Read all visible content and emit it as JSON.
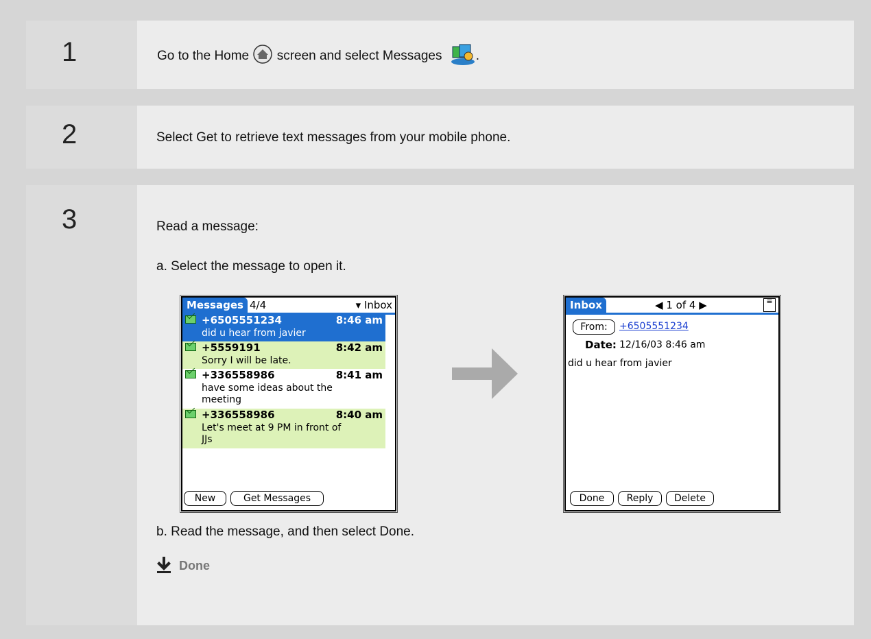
{
  "steps": [
    {
      "number": "1",
      "text_before": "Go to the Home",
      "text_middle": "screen and select Messages",
      "text_after": "."
    },
    {
      "number": "2",
      "text": "Select Get to retrieve text messages from your mobile phone."
    },
    {
      "number": "3",
      "intro": "Read a message:",
      "sub_a": "a.  Select the message to open it.",
      "sub_b": "b.  Read the message, and then select Done.",
      "done_label": "Done"
    }
  ],
  "icons": {
    "home": "home-icon",
    "messages": "messages-app-icon",
    "arrow": "right-arrow-icon",
    "done": "down-arrow-done-icon"
  },
  "colors": {
    "accent": "#1f6fd0",
    "highlight": "#ddf2b8",
    "selected": "#1f6fd0",
    "arrow": "#aaaaaa"
  },
  "screen1": {
    "tab": "Messages",
    "count": "4/4",
    "category": "Inbox",
    "messages": [
      {
        "number": "+6505551234",
        "time": "8:46 am",
        "body": "did u hear from javier"
      },
      {
        "number": "+5559191",
        "time": "8:42 am",
        "body": "Sorry I will be late."
      },
      {
        "number": "+336558986",
        "time": "8:41 am",
        "body": "have some ideas about the\nmeeting"
      },
      {
        "number": "+336558986",
        "time": "8:40 am",
        "body": "Let's meet at 9 PM in front of\nJJs"
      }
    ],
    "buttons": {
      "new": "New",
      "get": "Get Messages"
    }
  },
  "screen2": {
    "tab": "Inbox",
    "pager": "1 of 4",
    "from_label": "From:",
    "from_value": "+6505551234",
    "date_label": "Date:",
    "date_value": "12/16/03 8:46 am",
    "body": "did u hear from javier",
    "buttons": {
      "done": "Done",
      "reply": "Reply",
      "delete": "Delete"
    }
  }
}
